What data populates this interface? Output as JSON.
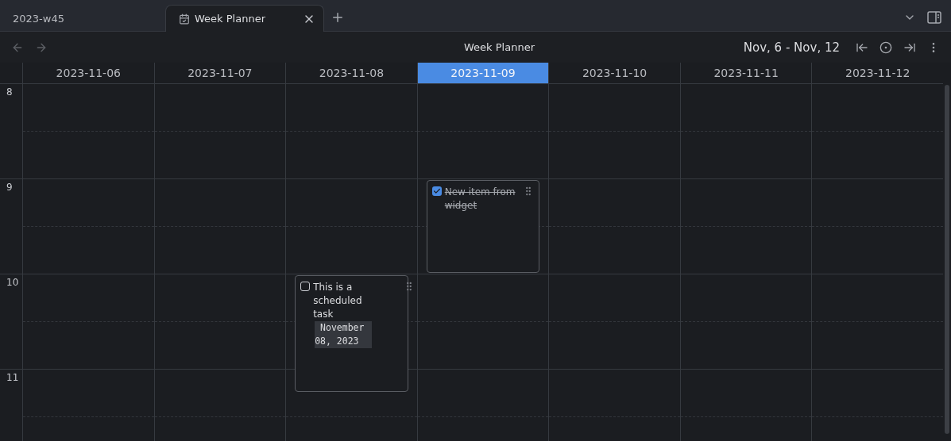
{
  "tabs": [
    {
      "label": "2023-w45",
      "selected": false,
      "kind": "note"
    },
    {
      "label": "Week Planner",
      "selected": true,
      "kind": "calendar"
    }
  ],
  "toolbar": {
    "title": "Week Planner",
    "range": "Nov, 6 - Nov, 12"
  },
  "days": [
    {
      "date": "2023-11-06",
      "selected": false
    },
    {
      "date": "2023-11-07",
      "selected": false
    },
    {
      "date": "2023-11-08",
      "selected": false
    },
    {
      "date": "2023-11-09",
      "selected": true
    },
    {
      "date": "2023-11-10",
      "selected": false
    },
    {
      "date": "2023-11-11",
      "selected": false
    },
    {
      "date": "2023-11-12",
      "selected": false
    }
  ],
  "hours": [
    {
      "label": "8"
    },
    {
      "label": "9",
      "cells": [
        {},
        {},
        {},
        {
          "events": [
            {
              "text": "New item from widget",
              "checked": true,
              "kind": "short"
            }
          ]
        },
        {},
        {},
        {}
      ]
    },
    {
      "label": "10",
      "cells": [
        {},
        {},
        {
          "events": [
            {
              "text": "This is a scheduled task",
              "date": " November 08, 2023",
              "checked": false,
              "kind": "long"
            }
          ]
        },
        {},
        {},
        {},
        {}
      ]
    },
    {
      "label": "11"
    }
  ]
}
